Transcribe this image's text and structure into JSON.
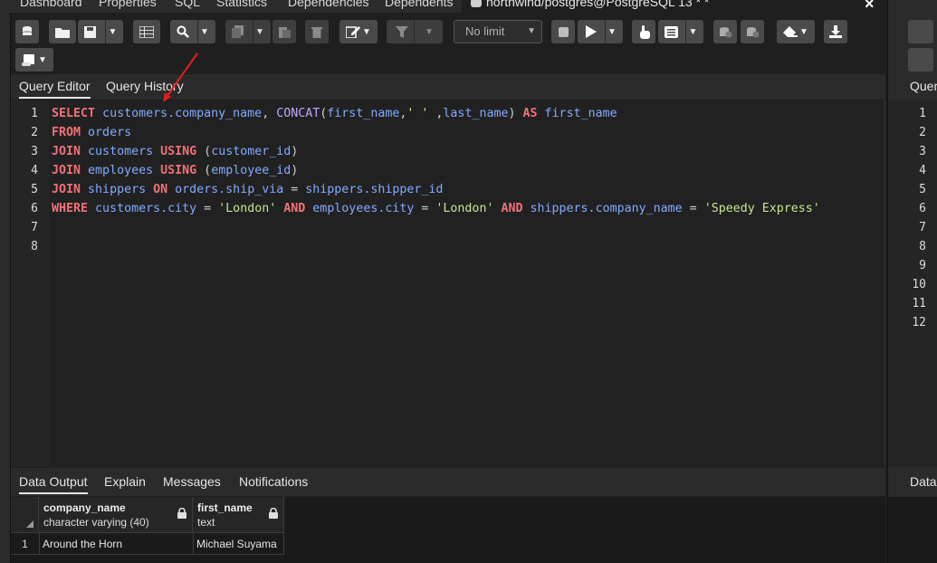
{
  "top_tabs": [
    {
      "label": "Dashboard"
    },
    {
      "label": "Properties"
    },
    {
      "label": "SQL"
    },
    {
      "label": "Statistics"
    },
    {
      "label": "Dependencies"
    },
    {
      "label": "Dependents"
    },
    {
      "label": "northwind/postgres@PostgreSQL 13 * *"
    }
  ],
  "toolbar": {
    "limit_value": "No limit"
  },
  "editor_tabs": [
    {
      "label": "Query Editor"
    },
    {
      "label": "Query History"
    }
  ],
  "editor": {
    "line_numbers": [
      "1",
      "2",
      "3",
      "4",
      "5",
      "6",
      "7",
      "8"
    ]
  },
  "output_tabs": [
    {
      "label": "Data Output"
    },
    {
      "label": "Explain"
    },
    {
      "label": "Messages"
    },
    {
      "label": "Notifications"
    }
  ],
  "grid": {
    "columns": [
      {
        "name": "company_name",
        "type": "character varying (40)"
      },
      {
        "name": "first_name",
        "type": "text"
      }
    ],
    "rows": [
      {
        "num": "1",
        "company_name": "Around the Horn",
        "first_name": "Michael Suyama"
      }
    ]
  },
  "side_panel": {
    "tab_label": "Quer",
    "out_label": "Data",
    "line_numbers": [
      "1",
      "2",
      "3",
      "4",
      "5",
      "6",
      "7",
      "8",
      "9",
      "10",
      "11",
      "12"
    ]
  }
}
